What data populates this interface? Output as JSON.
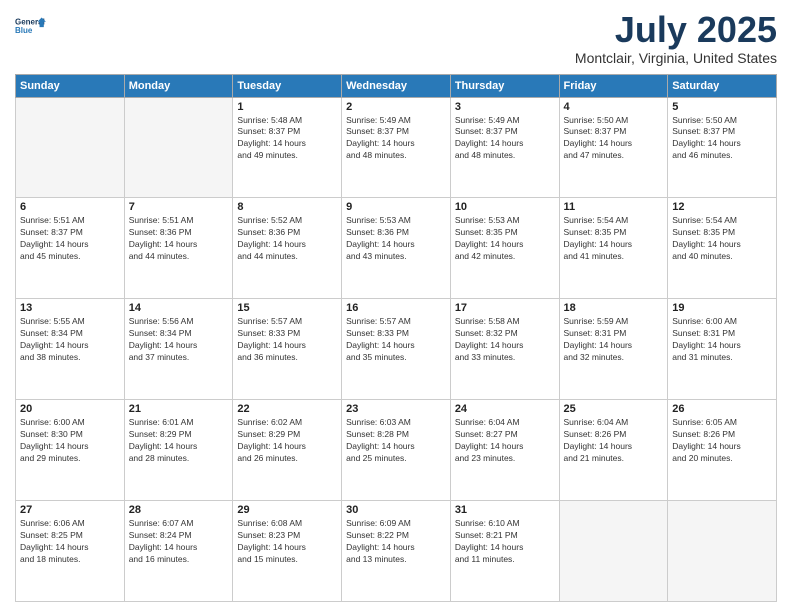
{
  "header": {
    "logo_line1": "General",
    "logo_line2": "Blue",
    "title": "July 2025",
    "subtitle": "Montclair, Virginia, United States"
  },
  "weekdays": [
    "Sunday",
    "Monday",
    "Tuesday",
    "Wednesday",
    "Thursday",
    "Friday",
    "Saturday"
  ],
  "weeks": [
    [
      {
        "day": "",
        "info": ""
      },
      {
        "day": "",
        "info": ""
      },
      {
        "day": "1",
        "info": "Sunrise: 5:48 AM\nSunset: 8:37 PM\nDaylight: 14 hours\nand 49 minutes."
      },
      {
        "day": "2",
        "info": "Sunrise: 5:49 AM\nSunset: 8:37 PM\nDaylight: 14 hours\nand 48 minutes."
      },
      {
        "day": "3",
        "info": "Sunrise: 5:49 AM\nSunset: 8:37 PM\nDaylight: 14 hours\nand 48 minutes."
      },
      {
        "day": "4",
        "info": "Sunrise: 5:50 AM\nSunset: 8:37 PM\nDaylight: 14 hours\nand 47 minutes."
      },
      {
        "day": "5",
        "info": "Sunrise: 5:50 AM\nSunset: 8:37 PM\nDaylight: 14 hours\nand 46 minutes."
      }
    ],
    [
      {
        "day": "6",
        "info": "Sunrise: 5:51 AM\nSunset: 8:37 PM\nDaylight: 14 hours\nand 45 minutes."
      },
      {
        "day": "7",
        "info": "Sunrise: 5:51 AM\nSunset: 8:36 PM\nDaylight: 14 hours\nand 44 minutes."
      },
      {
        "day": "8",
        "info": "Sunrise: 5:52 AM\nSunset: 8:36 PM\nDaylight: 14 hours\nand 44 minutes."
      },
      {
        "day": "9",
        "info": "Sunrise: 5:53 AM\nSunset: 8:36 PM\nDaylight: 14 hours\nand 43 minutes."
      },
      {
        "day": "10",
        "info": "Sunrise: 5:53 AM\nSunset: 8:35 PM\nDaylight: 14 hours\nand 42 minutes."
      },
      {
        "day": "11",
        "info": "Sunrise: 5:54 AM\nSunset: 8:35 PM\nDaylight: 14 hours\nand 41 minutes."
      },
      {
        "day": "12",
        "info": "Sunrise: 5:54 AM\nSunset: 8:35 PM\nDaylight: 14 hours\nand 40 minutes."
      }
    ],
    [
      {
        "day": "13",
        "info": "Sunrise: 5:55 AM\nSunset: 8:34 PM\nDaylight: 14 hours\nand 38 minutes."
      },
      {
        "day": "14",
        "info": "Sunrise: 5:56 AM\nSunset: 8:34 PM\nDaylight: 14 hours\nand 37 minutes."
      },
      {
        "day": "15",
        "info": "Sunrise: 5:57 AM\nSunset: 8:33 PM\nDaylight: 14 hours\nand 36 minutes."
      },
      {
        "day": "16",
        "info": "Sunrise: 5:57 AM\nSunset: 8:33 PM\nDaylight: 14 hours\nand 35 minutes."
      },
      {
        "day": "17",
        "info": "Sunrise: 5:58 AM\nSunset: 8:32 PM\nDaylight: 14 hours\nand 33 minutes."
      },
      {
        "day": "18",
        "info": "Sunrise: 5:59 AM\nSunset: 8:31 PM\nDaylight: 14 hours\nand 32 minutes."
      },
      {
        "day": "19",
        "info": "Sunrise: 6:00 AM\nSunset: 8:31 PM\nDaylight: 14 hours\nand 31 minutes."
      }
    ],
    [
      {
        "day": "20",
        "info": "Sunrise: 6:00 AM\nSunset: 8:30 PM\nDaylight: 14 hours\nand 29 minutes."
      },
      {
        "day": "21",
        "info": "Sunrise: 6:01 AM\nSunset: 8:29 PM\nDaylight: 14 hours\nand 28 minutes."
      },
      {
        "day": "22",
        "info": "Sunrise: 6:02 AM\nSunset: 8:29 PM\nDaylight: 14 hours\nand 26 minutes."
      },
      {
        "day": "23",
        "info": "Sunrise: 6:03 AM\nSunset: 8:28 PM\nDaylight: 14 hours\nand 25 minutes."
      },
      {
        "day": "24",
        "info": "Sunrise: 6:04 AM\nSunset: 8:27 PM\nDaylight: 14 hours\nand 23 minutes."
      },
      {
        "day": "25",
        "info": "Sunrise: 6:04 AM\nSunset: 8:26 PM\nDaylight: 14 hours\nand 21 minutes."
      },
      {
        "day": "26",
        "info": "Sunrise: 6:05 AM\nSunset: 8:26 PM\nDaylight: 14 hours\nand 20 minutes."
      }
    ],
    [
      {
        "day": "27",
        "info": "Sunrise: 6:06 AM\nSunset: 8:25 PM\nDaylight: 14 hours\nand 18 minutes."
      },
      {
        "day": "28",
        "info": "Sunrise: 6:07 AM\nSunset: 8:24 PM\nDaylight: 14 hours\nand 16 minutes."
      },
      {
        "day": "29",
        "info": "Sunrise: 6:08 AM\nSunset: 8:23 PM\nDaylight: 14 hours\nand 15 minutes."
      },
      {
        "day": "30",
        "info": "Sunrise: 6:09 AM\nSunset: 8:22 PM\nDaylight: 14 hours\nand 13 minutes."
      },
      {
        "day": "31",
        "info": "Sunrise: 6:10 AM\nSunset: 8:21 PM\nDaylight: 14 hours\nand 11 minutes."
      },
      {
        "day": "",
        "info": ""
      },
      {
        "day": "",
        "info": ""
      }
    ]
  ]
}
